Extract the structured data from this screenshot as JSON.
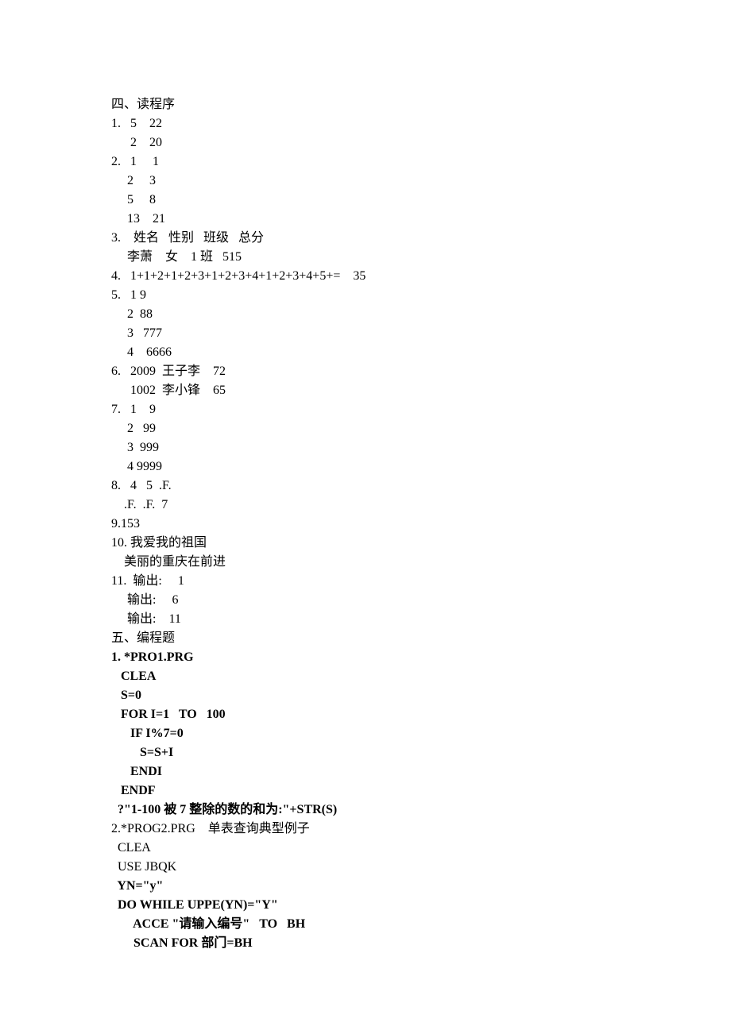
{
  "lines": [
    {
      "text": "四、读程序",
      "bold": false
    },
    {
      "text": "1.   5    22",
      "bold": false
    },
    {
      "text": "      2    20",
      "bold": false
    },
    {
      "text": "2.   1     1",
      "bold": false
    },
    {
      "text": "     2     3",
      "bold": false
    },
    {
      "text": "     5     8",
      "bold": false
    },
    {
      "text": "     13    21",
      "bold": false
    },
    {
      "text": "3.    姓名   性别   班级   总分",
      "bold": false
    },
    {
      "text": "     李萧    女    1 班   515",
      "bold": false
    },
    {
      "text": "4.   1+1+2+1+2+3+1+2+3+4+1+2+3+4+5+=    35",
      "bold": false
    },
    {
      "text": "5.   1 9",
      "bold": false
    },
    {
      "text": "     2  88",
      "bold": false
    },
    {
      "text": "     3   777",
      "bold": false
    },
    {
      "text": "     4    6666",
      "bold": false
    },
    {
      "text": "6.   2009  王子李    72",
      "bold": false
    },
    {
      "text": "      1002  李小锋    65",
      "bold": false
    },
    {
      "text": "7.   1    9",
      "bold": false
    },
    {
      "text": "     2   99",
      "bold": false
    },
    {
      "text": "     3  999",
      "bold": false
    },
    {
      "text": "     4 9999",
      "bold": false
    },
    {
      "text": "8.   4   5  .F.",
      "bold": false
    },
    {
      "text": "    .F.  .F.  7",
      "bold": false
    },
    {
      "text": "9.153",
      "bold": false
    },
    {
      "text": "10. 我爱我的祖国",
      "bold": false
    },
    {
      "text": "    美丽的重庆在前进",
      "bold": false
    },
    {
      "text": "11.  输出:     1",
      "bold": false
    },
    {
      "text": "     输出:     6",
      "bold": false
    },
    {
      "text": "     输出:    11",
      "bold": false
    },
    {
      "text": "五、编程题",
      "bold": false
    },
    {
      "text": "1. *PRO1.PRG",
      "bold": true
    },
    {
      "text": "   CLEA",
      "bold": true
    },
    {
      "text": "   S=0",
      "bold": true
    },
    {
      "text": "   FOR I=1   TO   100",
      "bold": true
    },
    {
      "text": "      IF I%7=0",
      "bold": true
    },
    {
      "text": "         S=S+I",
      "bold": true
    },
    {
      "text": "      ENDI",
      "bold": true
    },
    {
      "text": "   ENDF",
      "bold": true
    },
    {
      "text": "  ?\"1-100 被 7 整除的数的和为:\"+STR(S)",
      "bold": true
    },
    {
      "text": "2.*PROG2.PRG    单表查询典型例子",
      "bold": false
    },
    {
      "text": "  CLEA",
      "bold": false
    },
    {
      "text": "  USE JBQK",
      "bold": false
    },
    {
      "text": "  YN=\"y\"",
      "bold": true
    },
    {
      "text": "  DO WHILE UPPE(YN)=\"Y\"",
      "bold": true
    },
    {
      "text": "       ACCE \"请输入编号\"   TO   BH",
      "bold": true
    },
    {
      "text": "       SCAN FOR 部门=BH",
      "bold": true
    }
  ]
}
